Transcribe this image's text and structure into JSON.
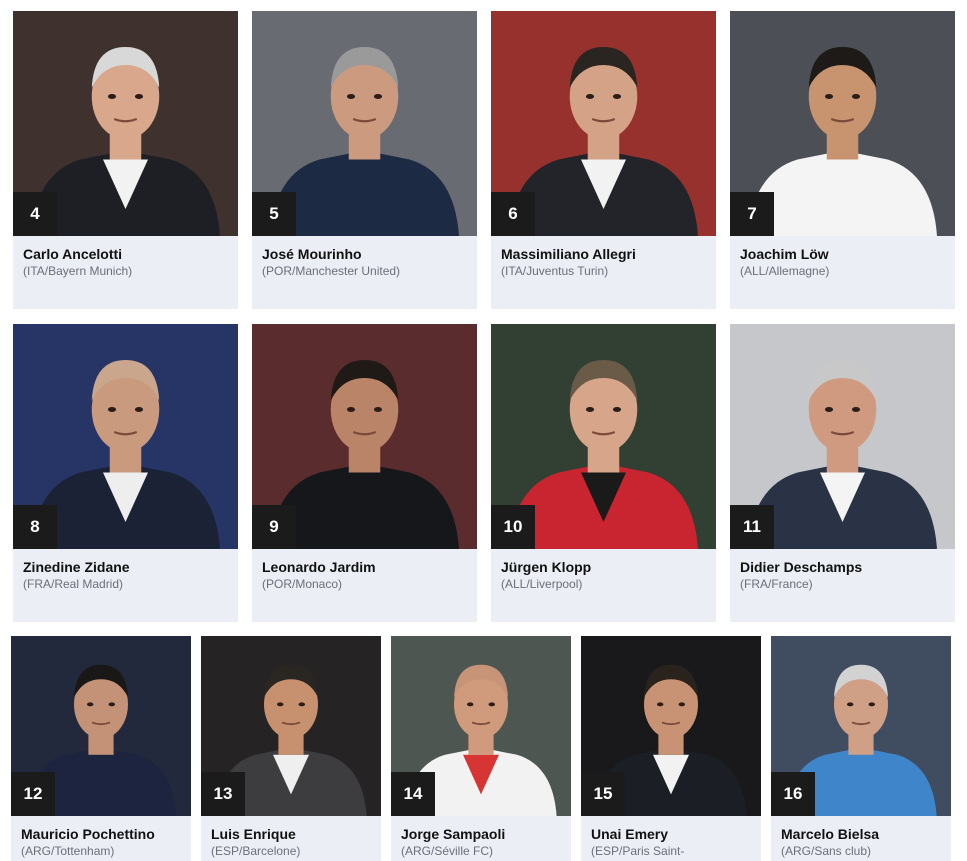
{
  "coaches": [
    {
      "rank": "4",
      "name": "Carlo Ancelotti",
      "info": "(ITA/Bayern Munich)",
      "bg": "#4a3a36",
      "suit": "#1e1f24",
      "shirt": "#f2f2f2",
      "hair": "#d8d8d8",
      "skin": "#d9a78b"
    },
    {
      "rank": "5",
      "name": "José Mourinho",
      "info": "(POR/Manchester United)",
      "bg": "#7b7e86",
      "suit": "#1d2a44",
      "shirt": "#1d2a44",
      "hair": "#9a9a9a",
      "skin": "#cc9a7f"
    },
    {
      "rank": "6",
      "name": "Massimiliano Allegri",
      "info": "(ITA/Juventus Turin)",
      "bg": "#b23a37",
      "suit": "#23242a",
      "shirt": "#f2f2f2",
      "hair": "#2a2520",
      "skin": "#d4a286"
    },
    {
      "rank": "7",
      "name": "Joachim Löw",
      "info": "(ALL/Allemagne)",
      "bg": "#5a5f66",
      "suit": "#f4f4f4",
      "shirt": "#f4f4f4",
      "hair": "#1d1a18",
      "skin": "#c8946f"
    },
    {
      "rank": "8",
      "name": "Zinedine Zidane",
      "info": "(FRA/Real Madrid)",
      "bg": "#2d3f78",
      "suit": "#1b2236",
      "shirt": "#eeeeee",
      "hair": "#c9a68c",
      "skin": "#c99a7d"
    },
    {
      "rank": "9",
      "name": "Leonardo Jardim",
      "info": "(POR/Monaco)",
      "bg": "#6b3437",
      "suit": "#16171b",
      "shirt": "#16171b",
      "hair": "#201a17",
      "skin": "#b98468"
    },
    {
      "rank": "10",
      "name": "Jürgen Klopp",
      "info": "(ALL/Liverpool)",
      "bg": "#3b4a3d",
      "suit": "#c82530",
      "shirt": "#1a1a1a",
      "hair": "#6a5a48",
      "skin": "#d7a68a"
    },
    {
      "rank": "11",
      "name": "Didier Deschamps",
      "info": "(FRA/France)",
      "bg": "#e8eaee",
      "suit": "#2a3346",
      "shirt": "#f4f4f4",
      "hair": "#c8c8c8",
      "skin": "#cf9a80"
    },
    {
      "rank": "12",
      "name": "Mauricio Pochettino",
      "info": "(ARG/Tottenham)",
      "bg": "#2a3148",
      "suit": "#1c2440",
      "shirt": "#1c2440",
      "hair": "#1a1816",
      "skin": "#c49276"
    },
    {
      "rank": "13",
      "name": "Luis Enrique",
      "info": "(ESP/Barcelone)",
      "bg": "#2c2a2a",
      "suit": "#3d3d3f",
      "shirt": "#efefef",
      "hair": "#2a2622",
      "skin": "#c7906f"
    },
    {
      "rank": "14",
      "name": "Jorge Sampaoli",
      "info": "(ARG/Séville FC)",
      "bg": "#5c6660",
      "suit": "#f2f2f2",
      "shirt": "#d73434",
      "hair": "#c89478",
      "skin": "#d09a7c"
    },
    {
      "rank": "15",
      "name": "Unai Emery",
      "info": "(ESP/Paris Saint-",
      "bg": "#1e1e22",
      "suit": "#1c1e26",
      "shirt": "#f2f2f2",
      "hair": "#2a221c",
      "skin": "#c89274"
    },
    {
      "rank": "16",
      "name": "Marcelo Bielsa",
      "info": "(ARG/Sans club)",
      "bg": "#4c5a70",
      "suit": "#3e86c9",
      "shirt": "#3e86c9",
      "hair": "#d2d2d2",
      "skin": "#cf9f86"
    }
  ]
}
